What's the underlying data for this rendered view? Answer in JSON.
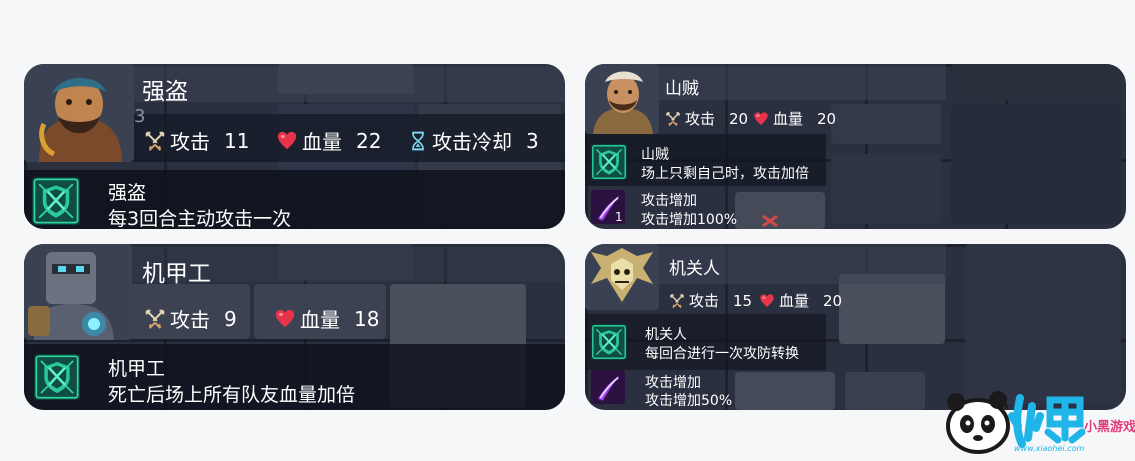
{
  "cards": {
    "bandit": {
      "name": "强盗",
      "stats": [
        {
          "label": "攻击",
          "value": "11",
          "icon": "crossed-swords-icon"
        },
        {
          "label": "血量",
          "value": "22",
          "icon": "heart-icon"
        },
        {
          "label": "攻击冷却",
          "value": "3",
          "icon": "hourglass-icon"
        }
      ],
      "skill": {
        "icon": "shield-skill-icon",
        "title": "强盗",
        "desc": "每3回合主动攻击一次"
      },
      "overlay_number": "3"
    },
    "mech": {
      "name": "机甲工",
      "stats": [
        {
          "label": "攻击",
          "value": "9",
          "icon": "crossed-swords-icon"
        },
        {
          "label": "血量",
          "value": "18",
          "icon": "heart-icon"
        }
      ],
      "skill": {
        "icon": "shield-skill-icon",
        "title": "机甲工",
        "desc": "死亡后场上所有队友血量加倍"
      }
    },
    "brigand": {
      "name": "山贼",
      "stats": [
        {
          "label": "攻击",
          "value": "20",
          "icon": "crossed-swords-icon"
        },
        {
          "label": "血量",
          "value": "20",
          "icon": "heart-icon"
        }
      ],
      "skills": [
        {
          "icon": "shield-skill-icon",
          "title": "山贼",
          "desc": "场上只剩自己时，攻击加倍"
        },
        {
          "icon": "purple-slash-icon",
          "title": "攻击增加",
          "desc": "攻击增加100%",
          "badge": "1"
        }
      ]
    },
    "puppet": {
      "name": "机关人",
      "stats": [
        {
          "label": "攻击",
          "value": "15",
          "icon": "crossed-swords-icon"
        },
        {
          "label": "血量",
          "value": "20",
          "icon": "heart-icon"
        }
      ],
      "skills": [
        {
          "icon": "shield-skill-icon",
          "title": "机关人",
          "desc": "每回合进行一次攻防转换"
        },
        {
          "icon": "purple-slash-icon",
          "title": "攻击增加",
          "desc": "攻击增加50%"
        }
      ]
    }
  },
  "watermark": {
    "logo_text": "小黑游戏",
    "url": "www.xiaohei.com"
  },
  "colors": {
    "heart": "#e8344a",
    "sword": "#e4d7b8",
    "hourglass": "#7fd6f0",
    "skill_green": "#2fd7a0",
    "skill_purple": "#9a40e8"
  }
}
